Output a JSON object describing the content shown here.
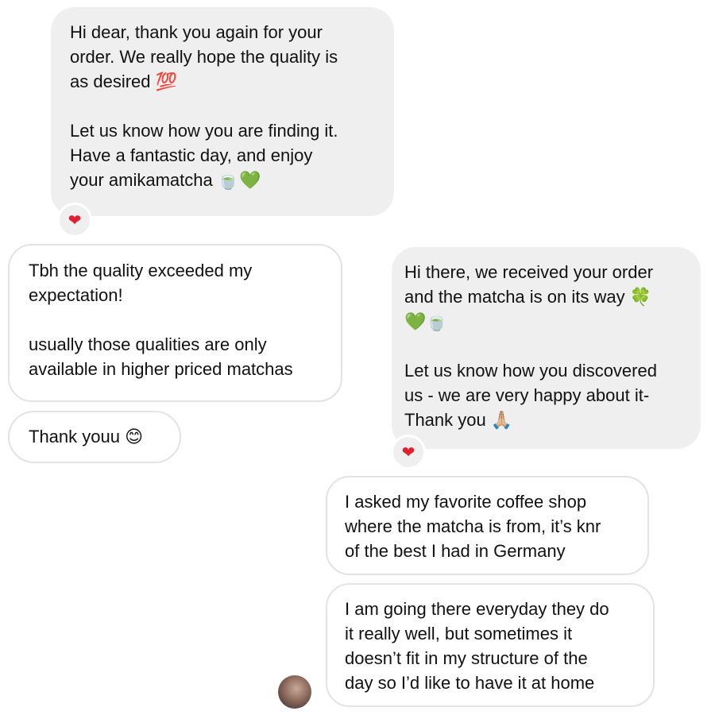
{
  "messages": [
    {
      "sender": "them",
      "paragraphs": [
        "Hi dear, thank you again for your\norder. We really hope the quality is\nas desired 💯",
        "Let us know how you are finding it.\nHave a fantastic day, and enjoy\nyour amikamatcha 🍵💚"
      ],
      "reaction": "❤"
    },
    {
      "sender": "me",
      "paragraphs": [
        "Tbh the quality exceeded my\nexpectation!",
        "usually those qualities are only\navailable in higher priced matchas"
      ]
    },
    {
      "sender": "me",
      "paragraphs": [
        "Thank youu 😊"
      ]
    },
    {
      "sender": "them",
      "paragraphs": [
        "Hi there, we received your order\nand the matcha is on its way 🍀\n💚🍵",
        "Let us know how you discovered\nus - we are very happy about it-\nThank you 🙏🏼"
      ],
      "reaction": "❤"
    },
    {
      "sender": "me",
      "paragraphs": [
        "I asked my favorite coffee shop\nwhere the matcha is from, it’s knr\nof the best I had in Germany"
      ]
    },
    {
      "sender": "me",
      "paragraphs": [
        "I am going there everyday they do\nit really well, but sometimes it\ndoesn’t fit in my structure of the\nday so I’d like to have it at home"
      ]
    }
  ],
  "avatar_icon": "user-avatar-photo",
  "colors": {
    "incoming_bubble": "#efefef",
    "outgoing_border": "#e3e3e3",
    "reaction_heart": "#e0202e"
  }
}
